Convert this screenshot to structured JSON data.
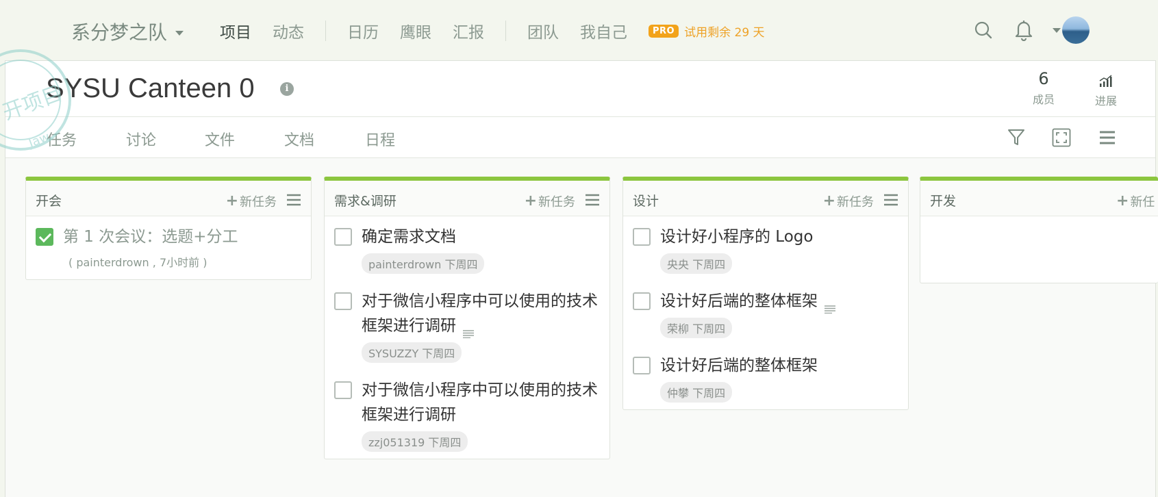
{
  "nav": {
    "team_name": "系分梦之队",
    "links": [
      "项目",
      "动态",
      "日历",
      "鹰眼",
      "汇报",
      "团队",
      "我自己"
    ],
    "pro_badge": "PRO",
    "trial_text": "试用剩余 29 天"
  },
  "project": {
    "title": "SYSU Canteen 0",
    "members_count": "6",
    "members_label": "成员",
    "progress_label": "进展"
  },
  "tabs": [
    "任务",
    "讨论",
    "文件",
    "文档",
    "日程"
  ],
  "columns": [
    {
      "title": "开会",
      "new_task": "新任务",
      "tasks": [
        {
          "title": "第 1 次会议：选题+分工",
          "done": true,
          "meta": "( painterdrown , 7小时前 )"
        }
      ]
    },
    {
      "title": "需求&调研",
      "new_task": "新任务",
      "tasks": [
        {
          "title": "确定需求文档",
          "done": false,
          "tag": "painterdrown 下周四"
        },
        {
          "title": "对于微信小程序中可以使用的技术框架进行调研",
          "done": false,
          "has_note": true,
          "tag": "SYSUZZY 下周四"
        },
        {
          "title": "对于微信小程序中可以使用的技术框架进行调研",
          "done": false,
          "tag": "zzj051319 下周四"
        }
      ]
    },
    {
      "title": "设计",
      "new_task": "新任务",
      "tasks": [
        {
          "title": "设计好小程序的 Logo",
          "done": false,
          "tag": "央央 下周四"
        },
        {
          "title": "设计好后端的整体框架",
          "done": false,
          "has_note": true,
          "tag": "荣柳 下周四"
        },
        {
          "title": "设计好后端的整体框架",
          "done": false,
          "tag": "仲攀 下周四"
        }
      ]
    },
    {
      "title": "开发",
      "new_task": "新任",
      "tasks": []
    }
  ],
  "colors": {
    "accent": "#8cc63f",
    "checked": "#5cb85c",
    "pro": "#f2a31b"
  }
}
